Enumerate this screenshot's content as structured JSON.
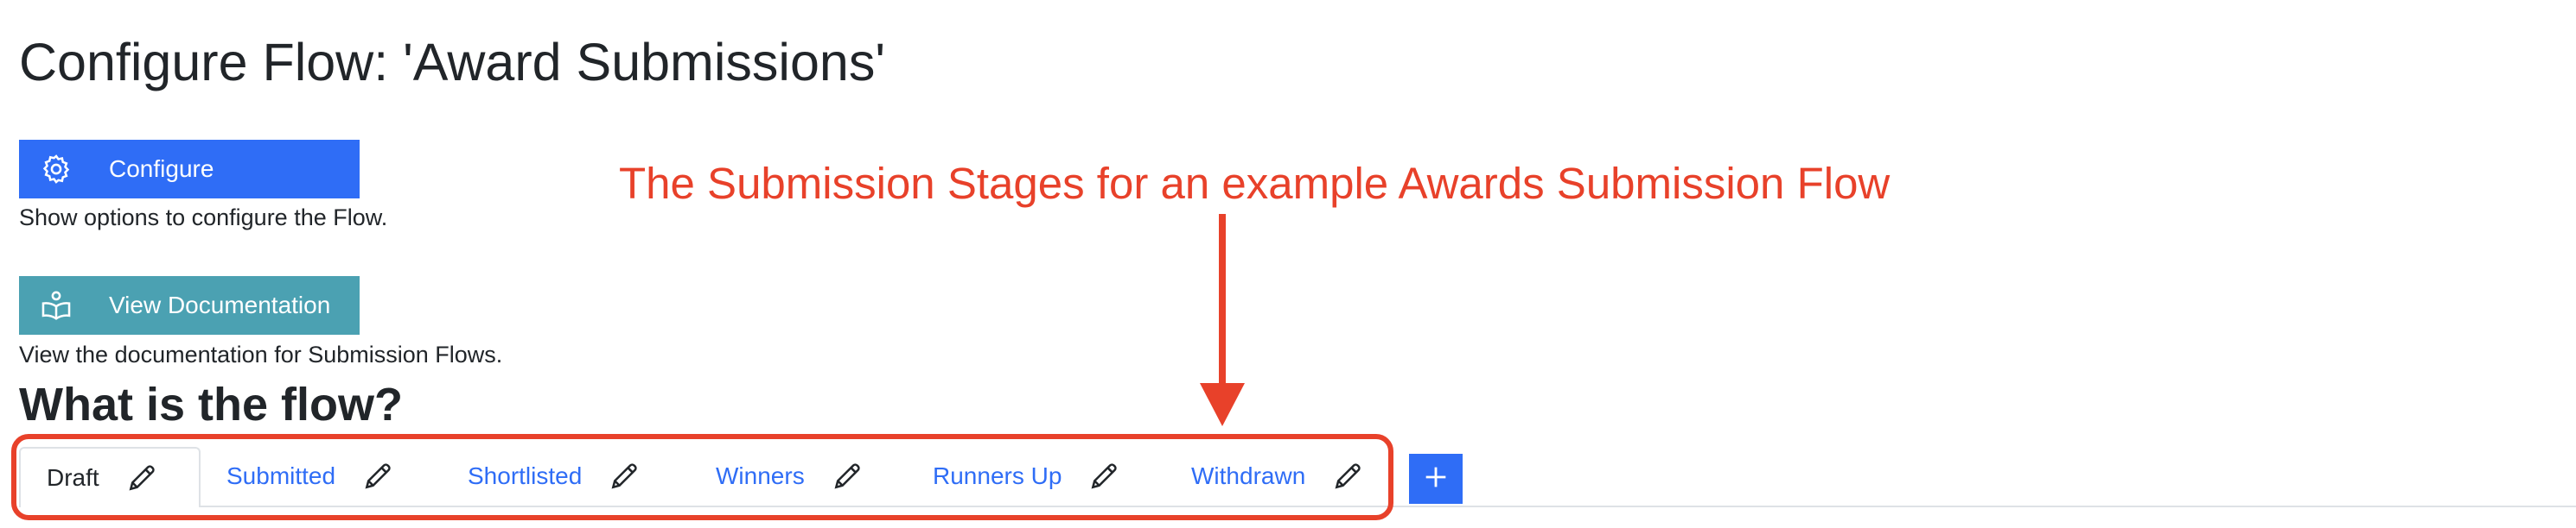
{
  "page": {
    "title": "Configure Flow: 'Award Submissions'"
  },
  "actions": {
    "configure": {
      "label": "Configure",
      "icon": "gear-icon",
      "help": "Show options to configure the Flow.",
      "color": "#2f6df6"
    },
    "documentation": {
      "label": "View Documentation",
      "icon": "open-book-icon",
      "help": "View the documentation for Submission Flows.",
      "color": "#4ba1b2"
    }
  },
  "flow": {
    "heading": "What is the flow?",
    "tabs": [
      {
        "label": "Draft",
        "active": true
      },
      {
        "label": "Submitted",
        "active": false
      },
      {
        "label": "Shortlisted",
        "active": false
      },
      {
        "label": "Winners",
        "active": false
      },
      {
        "label": "Runners Up",
        "active": false
      },
      {
        "label": "Withdrawn",
        "active": false
      }
    ],
    "add_tab_icon": "plus-icon"
  },
  "annotation": {
    "text": "The Submission Stages for an example Awards Submission Flow",
    "color": "#e8412a"
  },
  "colors": {
    "primary": "#2f6df6",
    "info": "#4ba1b2",
    "annotation": "#e8412a",
    "text": "#212529"
  }
}
